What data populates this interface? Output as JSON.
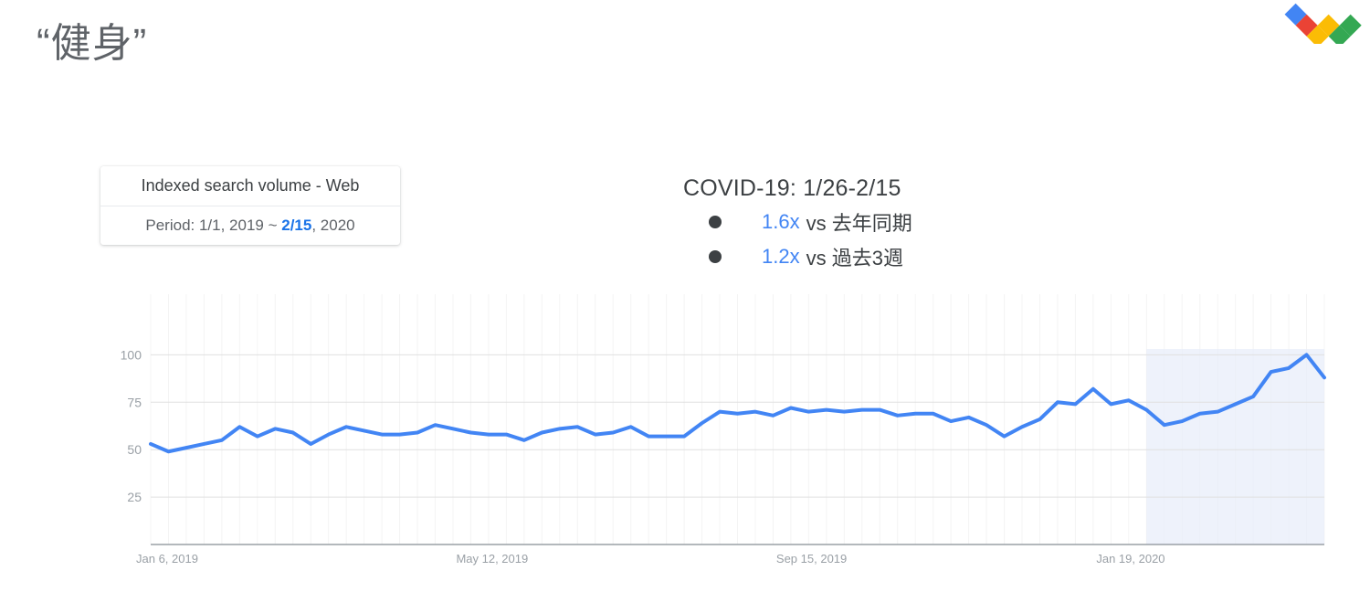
{
  "page_title": "“健身”",
  "logo": {
    "name": "google-trends-logo"
  },
  "info_card": {
    "metric_label": "Indexed search volume - Web",
    "period_prefix": "Period: 1/1, 2019 ~ ",
    "period_highlight": "2/15",
    "period_suffix": ", 2020"
  },
  "callout": {
    "title": "COVID-19: 1/26-2/15",
    "items": [
      {
        "multiplier": "1.6x",
        "comparison": "vs 去年同期"
      },
      {
        "multiplier": "1.2x",
        "comparison": "vs 過去3週"
      }
    ]
  },
  "colors": {
    "line": "#4285f4",
    "accent_blue": "#1a73e8",
    "highlight_band": "#e8eef9",
    "grid": "#e0e0e0",
    "text_gray": "#5f6368",
    "tick_gray": "#9aa0a6"
  },
  "chart_data": {
    "type": "line",
    "title": "",
    "xlabel": "",
    "ylabel": "",
    "ylim": [
      0,
      105
    ],
    "yticks": [
      25,
      50,
      75,
      100
    ],
    "grid": true,
    "legend": "none",
    "highlight_band": {
      "label": "COVID-19: 1/26-2/15",
      "start_index": 56,
      "end_index": 59
    },
    "xtick_labels": [
      "Jan 6, 2019",
      "May 12, 2019",
      "Sep 15, 2019",
      "Jan 19, 2020"
    ],
    "xtick_indices": [
      0,
      18,
      36,
      54
    ],
    "series": [
      {
        "name": "Indexed search volume - Web",
        "values": [
          53,
          49,
          51,
          53,
          55,
          62,
          57,
          61,
          59,
          53,
          58,
          62,
          60,
          58,
          58,
          59,
          63,
          61,
          59,
          58,
          58,
          55,
          59,
          61,
          62,
          58,
          59,
          62,
          57,
          57,
          57,
          64,
          70,
          69,
          70,
          68,
          72,
          70,
          71,
          70,
          71,
          71,
          68,
          69,
          69,
          65,
          67,
          63,
          57,
          62,
          66,
          75,
          74,
          82,
          74,
          76,
          71,
          63,
          65,
          69,
          70,
          74,
          78,
          91,
          93,
          100,
          88
        ]
      }
    ]
  }
}
